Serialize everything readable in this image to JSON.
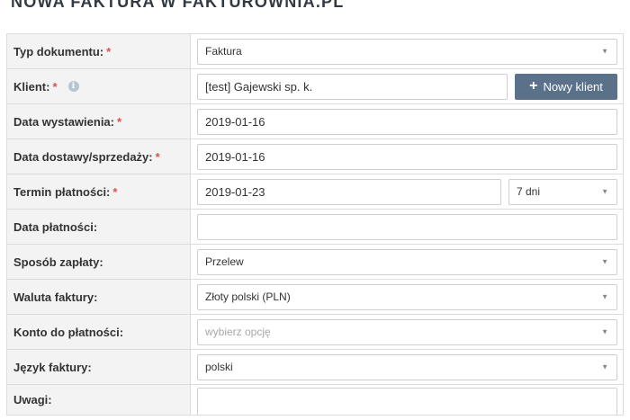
{
  "page": {
    "title": "Nowa faktura w Fakturownia.pl"
  },
  "form": {
    "required_mark": "*",
    "rows": [
      {
        "label": "Typ dokumentu:",
        "required": true,
        "value": "Faktura",
        "kind": "select"
      },
      {
        "label": "Klient:",
        "required": true,
        "value": "[test] Gajewski sp. k.",
        "kind": "input",
        "info_icon": "info-icon",
        "button_label": "Nowy klient",
        "button_icon": "plus-icon"
      },
      {
        "label": "Data wystawienia:",
        "required": true,
        "value": "2019-01-16",
        "kind": "input"
      },
      {
        "label": "Data dostawy/sprzedaży:",
        "required": true,
        "value": "2019-01-16",
        "kind": "input"
      },
      {
        "label": "Termin płatności:",
        "required": true,
        "value": "2019-01-23",
        "kind": "input",
        "term_value": "7 dni"
      },
      {
        "label": "Data płatności:",
        "required": false,
        "value": "",
        "kind": "input"
      },
      {
        "label": "Sposób zapłaty:",
        "required": false,
        "value": "Przelew",
        "kind": "select"
      },
      {
        "label": "Waluta faktury:",
        "required": false,
        "value": "Złoty polski (PLN)",
        "kind": "select"
      },
      {
        "label": "Konto do płatności:",
        "required": false,
        "placeholder": "wybierz opcję",
        "kind": "select"
      },
      {
        "label": "Język faktury:",
        "required": false,
        "value": "polski",
        "kind": "select"
      },
      {
        "label": "Uwagi:",
        "required": false,
        "value": "",
        "kind": "textarea"
      }
    ]
  },
  "colors": {
    "button_bg": "#5b7189",
    "required": "#d9534f",
    "label_bg": "#f3f3f3"
  }
}
